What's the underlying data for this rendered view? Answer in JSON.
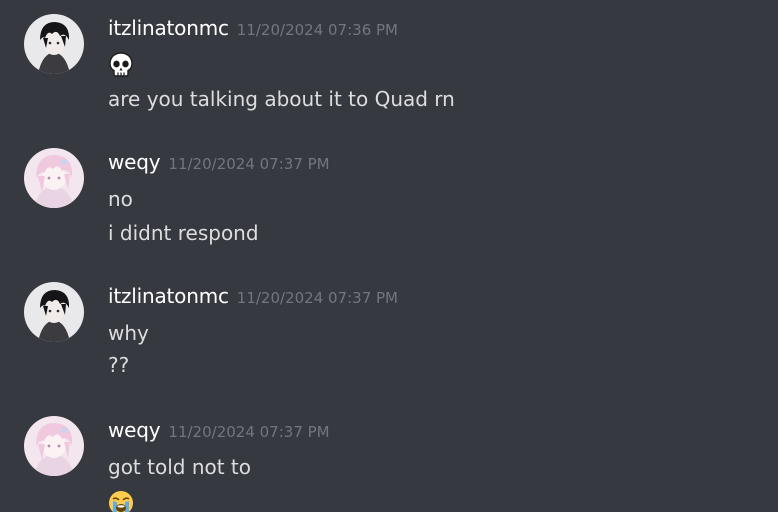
{
  "messages": [
    {
      "username": "itzlinatonmc",
      "timestamp": "11/20/2024 07:36 PM",
      "avatar": "dark-haired-avatar",
      "lines": [
        {
          "type": "emoji",
          "icon": "skull-emoji",
          "glyph": "💀"
        },
        {
          "type": "text",
          "text": "are you talking about it to Quad rn"
        }
      ]
    },
    {
      "username": "weqy",
      "timestamp": "11/20/2024 07:37 PM",
      "avatar": "pink-haired-avatar",
      "lines": [
        {
          "type": "text",
          "text": "no"
        },
        {
          "type": "text",
          "text": "i didnt respond"
        }
      ]
    },
    {
      "username": "itzlinatonmc",
      "timestamp": "11/20/2024 07:37 PM",
      "avatar": "dark-haired-avatar",
      "lines": [
        {
          "type": "text",
          "text": "why"
        },
        {
          "type": "text",
          "text": "??"
        }
      ]
    },
    {
      "username": "weqy",
      "timestamp": "11/20/2024 07:37 PM",
      "avatar": "pink-haired-avatar",
      "lines": [
        {
          "type": "text",
          "text": "got told not to"
        },
        {
          "type": "emoji",
          "icon": "loudly-crying-emoji",
          "glyph": "😭"
        }
      ]
    }
  ],
  "colors": {
    "background": "#36393f",
    "username": "#ffffff",
    "timestamp": "#72767d",
    "message_text": "#dcddde"
  }
}
